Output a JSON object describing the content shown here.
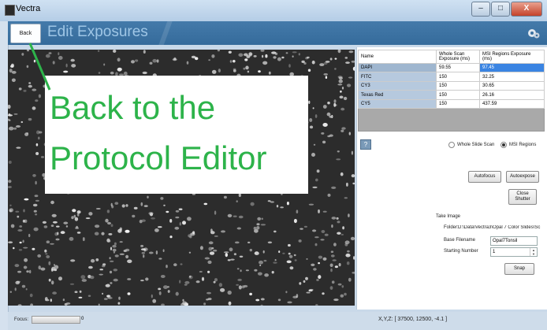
{
  "window": {
    "title": "Vectra",
    "buttons": {
      "minimize": "–",
      "maximize": "□",
      "close": "X"
    }
  },
  "header": {
    "back_label": "Back",
    "page_title": "Edit Exposures"
  },
  "annotation": {
    "line1": "Back to the",
    "line2": "Protocol Editor",
    "color": "#2db34a"
  },
  "table": {
    "headers": [
      "Name",
      "Whole Scan Exposure (ms)",
      "MSI Regions Exposure (ms)"
    ],
    "rows": [
      {
        "name": "DAPI",
        "whole": "59.55",
        "msi": "97.45"
      },
      {
        "name": "FITC",
        "whole": "150",
        "msi": "32.25"
      },
      {
        "name": "CY3",
        "whole": "150",
        "msi": "30.65"
      },
      {
        "name": "Texas Red",
        "whole": "150",
        "msi": "26.16"
      },
      {
        "name": "CY5",
        "whole": "150",
        "msi": "437.59"
      }
    ]
  },
  "mode": {
    "option1": "Whole Slide Scan",
    "option2": "MSI Regions",
    "selected": "MSI Regions"
  },
  "buttons": {
    "autofocus": "Autofocus",
    "autoexpose": "Autoexpose",
    "close_shutter_1": "Close",
    "close_shutter_2": "Shutter",
    "snap": "Snap"
  },
  "take_image": {
    "section_label": "Take Image",
    "folder_label": "Folder:",
    "folder_value": "D:\\Data\\Vectra3\\Opal 7 Color Slides\\Sc",
    "base_filename_label": "Base Filename",
    "base_filename_value": "Opal7Tonsil",
    "starting_number_label": "Starting Number",
    "starting_number_value": "1"
  },
  "status": {
    "focus_label": "Focus:",
    "focus_value": "0",
    "xyz_text": "X,Y,Z: [  37500,  12500,    -4.1 ]"
  },
  "colors": {
    "header_blue": "#3a70a0",
    "selection_blue": "#3a84e2"
  }
}
